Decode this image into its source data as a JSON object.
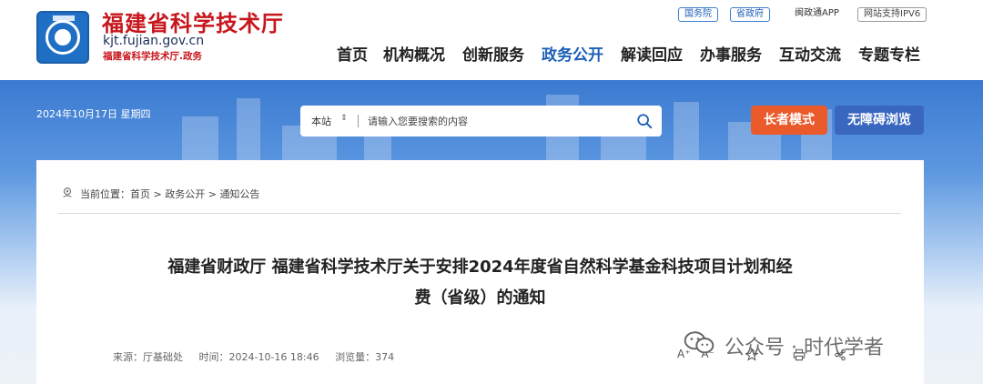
{
  "header": {
    "site_name": "福建省科学技术厅",
    "domain": "kjt.fujian.gov.cn",
    "sub": "福建省科学技术厅.政务",
    "top_links": [
      "国务院",
      "省政府",
      "闽政通APP",
      "网站支持IPV6"
    ],
    "nav": [
      "首页",
      "机构概况",
      "创新服务",
      "政务公开",
      "解读回应",
      "办事服务",
      "互动交流",
      "专题专栏"
    ],
    "active_nav": "政务公开"
  },
  "banner": {
    "date": "2024年10月17日 星期四",
    "search_scope": "本站",
    "search_placeholder": "请输入您要搜索的内容",
    "elder_mode": "长者模式",
    "accessible": "无障碍浏览"
  },
  "breadcrumb": {
    "label": "当前位置：",
    "items": [
      "首页",
      "政务公开",
      "通知公告"
    ]
  },
  "article": {
    "title_line1": "福建省财政厅 福建省科学技术厅关于安排2024年度省自然科学基金科技项目计划和经",
    "title_line2": "费（省级）的通知",
    "source": "来源：厅基础处",
    "time": "时间：2024-10-16 18:46",
    "views": "浏览量：374"
  },
  "tools": {
    "font_large": "A⁺",
    "font_small": "A⁻"
  },
  "watermark": {
    "text": "公众号 · 时代学者"
  },
  "colors": {
    "brand_red": "#c8161d",
    "brand_blue": "#1c5fb5",
    "elder_btn": "#ea5a2a",
    "access_btn": "#3967c0"
  }
}
